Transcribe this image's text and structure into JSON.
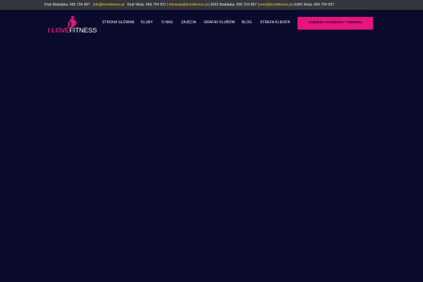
{
  "topbar": {
    "club_bialoleka_label": "Klub Białołęka: 666 704 887",
    "club_bialoleka_email": "info@ilovefitness.pl",
    "club_wola_label": "Klub Wola: 666 704 937 |",
    "club_wola_email": "infowola@ilovefitness.pl",
    "ems_bialoleka_label": "| EMS Białołęka: 666 704 887 |",
    "ems_email": "ems@ilovefitness.pl",
    "ems_wola_label": "| EMS Wola: 666 704 937"
  },
  "logo": {
    "part1": "I LOVE",
    "part2": "FITNESS"
  },
  "nav": {
    "items": [
      {
        "label": "STRONA GŁÓWNA"
      },
      {
        "label": "KLUBY"
      },
      {
        "label": "O NAS"
      },
      {
        "label": "ZAJĘCIA"
      },
      {
        "label": "GRAFIKI KLUBÓW"
      },
      {
        "label": "BLOG"
      },
      {
        "label": "STREFA KLIENTA"
      }
    ],
    "cta_label": "ODBIERZ DARMOWY TRENING"
  },
  "colors": {
    "background": "#0a0a2c",
    "topbar": "#35353d",
    "accent": "#e8147e",
    "link": "#f2c21a"
  }
}
